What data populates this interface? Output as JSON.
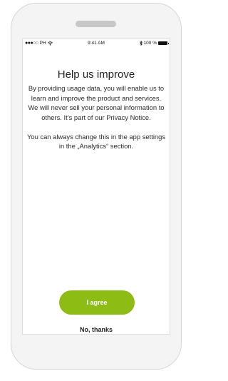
{
  "statusbar": {
    "signal": "●●●○○",
    "carrier": "PH",
    "wifi_icon": "wifi-icon",
    "time": "9:41 AM",
    "bluetooth_icon": "bluetooth-icon",
    "battery_percent": "100 %"
  },
  "screen": {
    "title": "Help us improve",
    "paragraph_1": "By providing usage data, you will enable us to learn and improve the product and services. We will never sell your personal information to others. It’s part of our Privacy Notice.",
    "paragraph_2": "You can always change this in the app settings in the „Analytics“ section."
  },
  "actions": {
    "agree_label": "I agree",
    "decline_label": "No, thanks"
  },
  "colors": {
    "accent": "#8dbd14"
  }
}
